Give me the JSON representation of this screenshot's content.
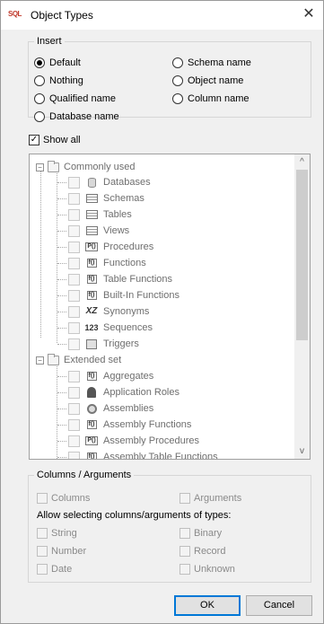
{
  "window": {
    "title": "Object Types",
    "app_icon_text": "SQL",
    "close_glyph": "✕"
  },
  "insert": {
    "legend": "Insert",
    "options": [
      {
        "label": "Default",
        "selected": true
      },
      {
        "label": "Nothing",
        "selected": false
      },
      {
        "label": "Qualified name",
        "selected": false
      },
      {
        "label": "Database name",
        "selected": false
      },
      {
        "label": "Schema name",
        "selected": false
      },
      {
        "label": "Object name",
        "selected": false
      },
      {
        "label": "Column name",
        "selected": false
      }
    ]
  },
  "show_all": {
    "label": "Show all",
    "checked": true
  },
  "tree": {
    "groups": [
      {
        "label": "Commonly used",
        "expanded": true,
        "items": [
          {
            "label": "Databases",
            "icon": "database-icon"
          },
          {
            "label": "Schemas",
            "icon": "schema-icon"
          },
          {
            "label": "Tables",
            "icon": "table-icon"
          },
          {
            "label": "Views",
            "icon": "view-icon"
          },
          {
            "label": "Procedures",
            "icon": "procedure-icon"
          },
          {
            "label": "Functions",
            "icon": "function-icon"
          },
          {
            "label": "Table Functions",
            "icon": "function-icon"
          },
          {
            "label": "Built-In Functions",
            "icon": "function-icon"
          },
          {
            "label": "Synonyms",
            "icon": "synonym-icon"
          },
          {
            "label": "Sequences",
            "icon": "sequence-icon"
          },
          {
            "label": "Triggers",
            "icon": "trigger-icon"
          }
        ]
      },
      {
        "label": "Extended set",
        "expanded": true,
        "items": [
          {
            "label": "Aggregates",
            "icon": "function-icon"
          },
          {
            "label": "Application Roles",
            "icon": "role-icon"
          },
          {
            "label": "Assemblies",
            "icon": "assembly-icon"
          },
          {
            "label": "Assembly Functions",
            "icon": "function-icon"
          },
          {
            "label": "Assembly Procedures",
            "icon": "procedure-icon"
          },
          {
            "label": "Assembly Table Functions",
            "icon": "function-icon"
          }
        ]
      }
    ],
    "scroll_up_glyph": "^",
    "scroll_down_glyph": "v"
  },
  "columns_arguments": {
    "legend": "Columns / Arguments",
    "columns_label": "Columns",
    "arguments_label": "Arguments",
    "types_caption": "Allow selecting columns/arguments of types:",
    "types": [
      "String",
      "Binary",
      "Number",
      "Record",
      "Date",
      "Unknown"
    ]
  },
  "buttons": {
    "ok": "OK",
    "cancel": "Cancel"
  }
}
